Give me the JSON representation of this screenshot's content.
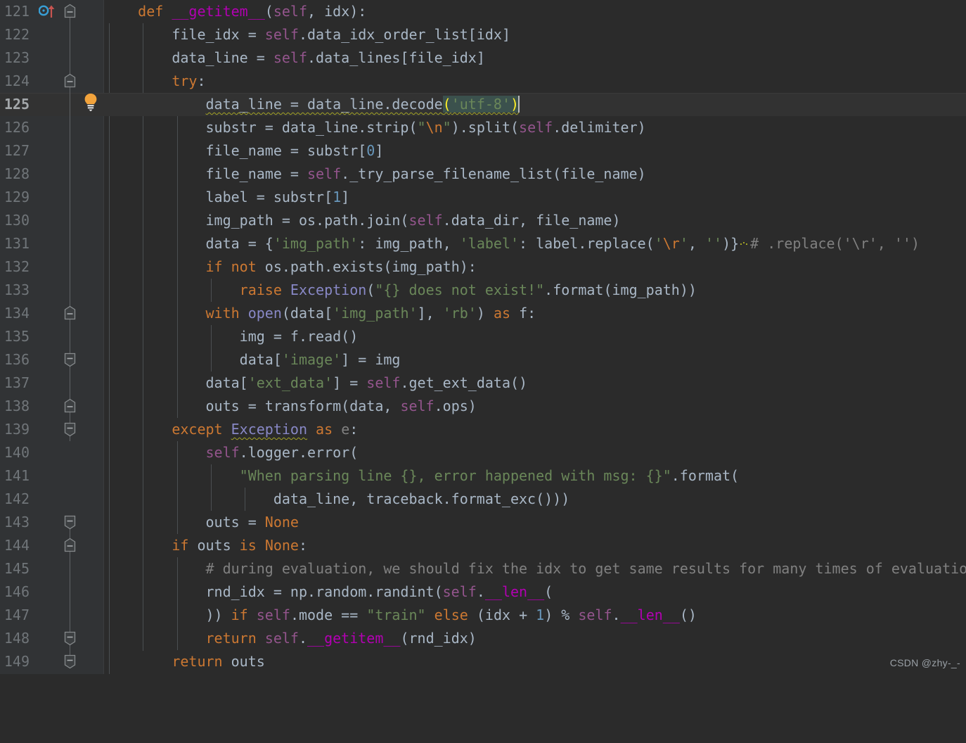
{
  "editor": {
    "theme": "darcula",
    "background": "#2b2b2b",
    "gutter_background": "#313335",
    "current_line_background": "#323232",
    "default_text_color": "#a9b7c6",
    "keyword_color": "#cc7832",
    "string_color": "#6a8759",
    "number_color": "#6897bb",
    "comment_color": "#808080",
    "self_color": "#94558d",
    "magic_method_color": "#b200b2",
    "builtin_color": "#8888c6",
    "bracket_match_background": "#3b514d",
    "bracket_match_color": "#ffef28",
    "first_line": 121,
    "last_line": 149,
    "current_line": 125
  },
  "gutter": {
    "icons": [
      {
        "name": "implementing-method-icon",
        "line": 121,
        "tooltip": "Implements method"
      },
      {
        "name": "intention-bulb-icon",
        "line": 125,
        "tooltip": "Show intention actions"
      }
    ],
    "fold_markers": [
      {
        "line": 121,
        "state": "expanded"
      },
      {
        "line": 124,
        "state": "expanded"
      },
      {
        "line": 134,
        "state": "expanded"
      },
      {
        "line": 136,
        "state": "expanded"
      },
      {
        "line": 138,
        "state": "expanded"
      },
      {
        "line": 139,
        "state": "expanded"
      },
      {
        "line": 143,
        "state": "expanded"
      },
      {
        "line": 144,
        "state": "expanded"
      },
      {
        "line": 148,
        "state": "expanded"
      },
      {
        "line": 149,
        "state": "expanded"
      }
    ]
  },
  "line_numbers": [
    "121",
    "122",
    "123",
    "124",
    "125",
    "126",
    "127",
    "128",
    "129",
    "130",
    "131",
    "132",
    "133",
    "134",
    "135",
    "136",
    "137",
    "138",
    "139",
    "140",
    "141",
    "142",
    "143",
    "144",
    "145",
    "146",
    "147",
    "148",
    "149"
  ],
  "code_lines": [
    {
      "n": "121",
      "text": "    def __getitem__(self, idx):"
    },
    {
      "n": "122",
      "text": "        file_idx = self.data_idx_order_list[idx]"
    },
    {
      "n": "123",
      "text": "        data_line = self.data_lines[file_idx]"
    },
    {
      "n": "124",
      "text": "        try:"
    },
    {
      "n": "125",
      "text": "            data_line = data_line.decode('utf-8')"
    },
    {
      "n": "126",
      "text": "            substr = data_line.strip(\"\\n\").split(self.delimiter)"
    },
    {
      "n": "127",
      "text": "            file_name = substr[0]"
    },
    {
      "n": "128",
      "text": "            file_name = self._try_parse_filename_list(file_name)"
    },
    {
      "n": "129",
      "text": "            label = substr[1]"
    },
    {
      "n": "130",
      "text": "            img_path = os.path.join(self.data_dir, file_name)"
    },
    {
      "n": "131",
      "text": "            data = {'img_path': img_path, 'label': label.replace('\\r', '')} # .replace('\\r', '')"
    },
    {
      "n": "132",
      "text": "            if not os.path.exists(img_path):"
    },
    {
      "n": "133",
      "text": "                raise Exception(\"{} does not exist!\".format(img_path))"
    },
    {
      "n": "134",
      "text": "            with open(data['img_path'], 'rb') as f:"
    },
    {
      "n": "135",
      "text": "                img = f.read()"
    },
    {
      "n": "136",
      "text": "                data['image'] = img"
    },
    {
      "n": "137",
      "text": "            data['ext_data'] = self.get_ext_data()"
    },
    {
      "n": "138",
      "text": "            outs = transform(data, self.ops)"
    },
    {
      "n": "139",
      "text": "        except Exception as e:"
    },
    {
      "n": "140",
      "text": "            self.logger.error("
    },
    {
      "n": "141",
      "text": "                \"When parsing line {}, error happened with msg: {}\".format("
    },
    {
      "n": "142",
      "text": "                    data_line, traceback.format_exc()))"
    },
    {
      "n": "143",
      "text": "            outs = None"
    },
    {
      "n": "144",
      "text": "        if outs is None:"
    },
    {
      "n": "145",
      "text": "            # during evaluation, we should fix the idx to get same results for many times of evaluation."
    },
    {
      "n": "146",
      "text": "            rnd_idx = np.random.randint(self.__len__("
    },
    {
      "n": "147",
      "text": "            )) if self.mode == \"train\" else (idx + 1) % self.__len__()"
    },
    {
      "n": "148",
      "text": "            return self.__getitem__(rnd_idx)"
    },
    {
      "n": "149",
      "text": "        return outs"
    }
  ],
  "annotations": {
    "warning_squiggle_lines": [
      125,
      131,
      139
    ],
    "caret_line": 125,
    "caret_column_after": "')"
  },
  "watermark": {
    "text": "CSDN @zhy-_-"
  }
}
